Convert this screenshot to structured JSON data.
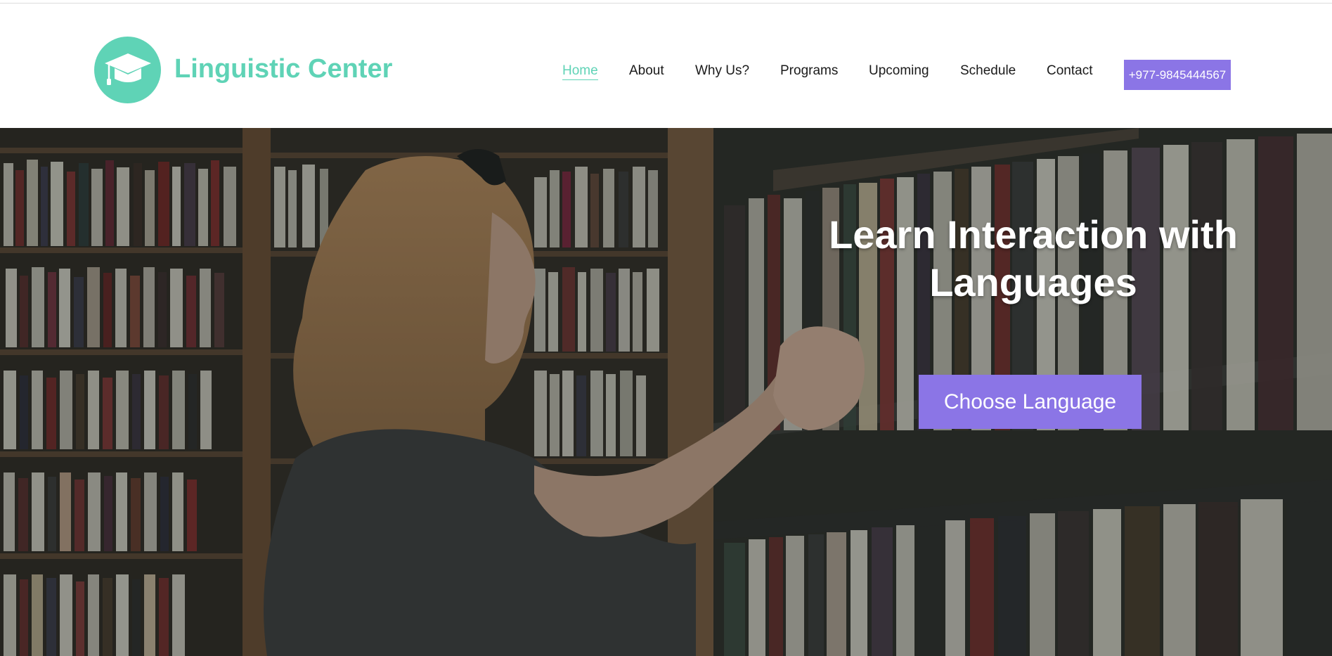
{
  "brand": {
    "name": "Linguistic Center",
    "logo_icon": "graduation-cap-icon",
    "accent_color": "#5fd3b6"
  },
  "nav": {
    "items": [
      {
        "label": "Home",
        "active": true
      },
      {
        "label": "About"
      },
      {
        "label": "Why Us?"
      },
      {
        "label": "Programs"
      },
      {
        "label": "Upcoming"
      },
      {
        "label": "Schedule"
      },
      {
        "label": "Contact"
      }
    ],
    "phone": "+977-9845444567",
    "button_color": "#8b75e6"
  },
  "hero": {
    "title": "Learn Interaction with Languages",
    "cta_label": "Choose Language",
    "background": "photo of a woman browsing library bookshelves"
  }
}
